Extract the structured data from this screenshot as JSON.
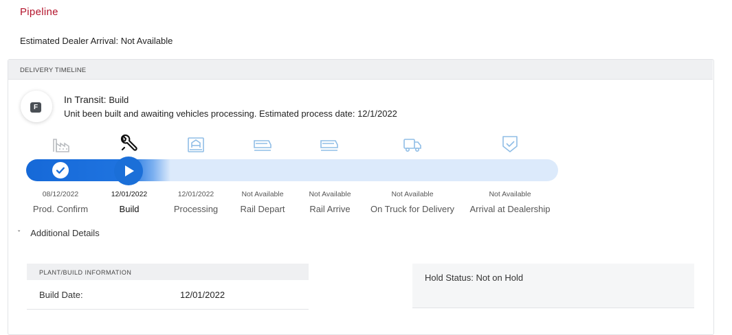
{
  "header": {
    "title": "Pipeline",
    "eta_label": "Estimated Dealer Arrival:",
    "eta_value": "Not Available"
  },
  "timeline": {
    "header_label": "DELIVERY TIMELINE",
    "status": {
      "badge_letter": "F",
      "title": "In Transit:",
      "stage": "Build",
      "description": "Unit been built and awaiting vehicles processing. Estimated process date: 12/1/2022"
    },
    "progress": {
      "completed_steps": 1,
      "current_step": 2,
      "total_steps": 7
    },
    "steps": [
      {
        "label": "Prod. Confirm",
        "date": "08/12/2022",
        "icon": "factory-icon",
        "state": "done"
      },
      {
        "label": "Build",
        "date": "12/01/2022",
        "icon": "wrench-icon",
        "state": "current"
      },
      {
        "label": "Processing",
        "date": "12/01/2022",
        "icon": "processing-icon",
        "state": "pending"
      },
      {
        "label": "Rail Depart",
        "date": "Not Available",
        "icon": "rail-icon",
        "state": "pending"
      },
      {
        "label": "Rail Arrive",
        "date": "Not Available",
        "icon": "rail-icon",
        "state": "pending"
      },
      {
        "label": "On Truck for Delivery",
        "date": "Not Available",
        "icon": "truck-icon",
        "state": "pending"
      },
      {
        "label": "Arrival at Dealership",
        "date": "Not Available",
        "icon": "shield-check-icon",
        "state": "pending"
      }
    ]
  },
  "additional": {
    "toggle_label": "Additional Details",
    "plant": {
      "header": "PLANT/BUILD INFORMATION",
      "build_date_label": "Build Date:",
      "build_date_value": "12/01/2022"
    },
    "hold": {
      "label": "Hold Status:",
      "value": "Not on Hold"
    }
  },
  "colors": {
    "brand_red": "#b3132b",
    "progress_blue": "#1b6fd8",
    "track_light": "#dceafb",
    "icon_inactive": "#8fbde6"
  }
}
